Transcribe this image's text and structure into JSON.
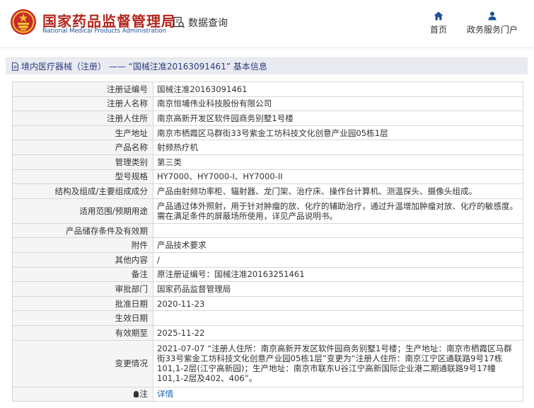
{
  "header": {
    "brand_cn": "国家药品监督管理局",
    "brand_en": "National Medical Products Administration",
    "query_label": "数据查询",
    "nav": [
      {
        "label": "首页",
        "icon": "home-icon"
      },
      {
        "label": "政务服务门户",
        "icon": "user-icon"
      }
    ],
    "brand_color": "#b3261e"
  },
  "title": "境内医疗器械（注册） —— “国械注准20163091461” 基本信息",
  "rows": [
    {
      "key": "注册证编号",
      "value": "国械注准20163091461"
    },
    {
      "key": "注册人名称",
      "value": "南京恒埔伟业科技股份有限公司"
    },
    {
      "key": "注册人住所",
      "value": "南京高新开发区软件园商务别墅1号楼"
    },
    {
      "key": "生产地址",
      "value": "南京市栖霞区马群街33号紫金工坊科技文化创意产业园05栋1层"
    },
    {
      "key": "产品名称",
      "value": "射频热疗机"
    },
    {
      "key": "管理类别",
      "value": "第三类"
    },
    {
      "key": "型号规格",
      "value": "HY7000、HY7000-I、HY7000-II"
    },
    {
      "key": "结构及组成/主要组成成分",
      "value": "产品由射频功率柜、辐射器、龙门架、治疗床、操作台计算机、测温探头、摄像头组成。"
    },
    {
      "key": "适用范围/预期用途",
      "value": "产品通过体外照射，用于针对肿瘤的放、化疗的辅助治疗，通过升温增加肿瘤对放、化疗的敏感度。需在满足条件的屏蔽场所使用，详见产品说明书。"
    },
    {
      "key": "产品储存条件及有效期",
      "value": ""
    },
    {
      "key": "附件",
      "value": "产品技术要求"
    },
    {
      "key": "其他内容",
      "value": "/"
    },
    {
      "key": "备注",
      "value": "原注册证编号：国械注准20163251461"
    },
    {
      "key": "审批部门",
      "value": "国家药品监督管理局"
    },
    {
      "key": "批准日期",
      "value": "2020-11-23"
    },
    {
      "key": "生效日期",
      "value": ""
    },
    {
      "key": "有效期至",
      "value": "2025-11-22"
    },
    {
      "key": "变更情况",
      "value": "2021-07-07 “注册人住所：南京高新开发区软件园商务别墅1号楼；生产地址：南京市栖霞区马群街33号紫金工坊科技文化创意产业园05栋1层”变更为“注册人住所：南京江宁区通联路9号17栋101,1-2层(江宁高新园)；生产地址：南京市联东U谷江宁高新国际企业港二期通联路9号17幢101,1-2层及402、406”。"
    },
    {
      "key": "注",
      "value": "详情"
    }
  ]
}
